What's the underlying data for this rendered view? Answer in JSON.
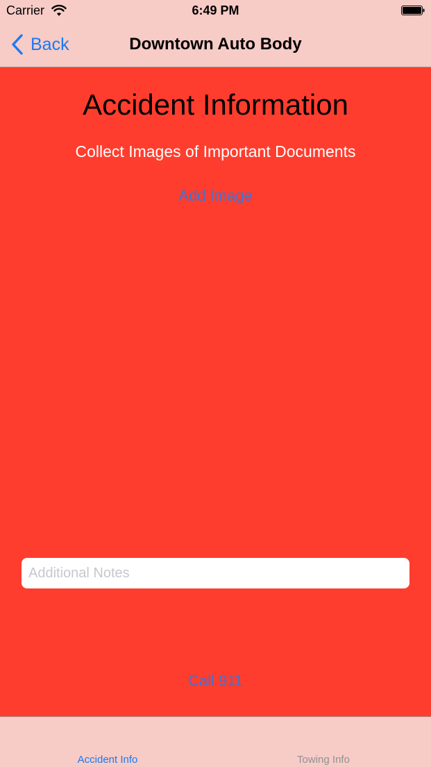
{
  "status_bar": {
    "carrier": "Carrier",
    "time": "6:49 PM"
  },
  "nav": {
    "back_label": "Back",
    "title": "Downtown Auto Body"
  },
  "main": {
    "title": "Accident Information",
    "subtitle": "Collect Images of Important Documents",
    "add_image_label": "Add Image",
    "notes": {
      "value": "",
      "placeholder": "Additional Notes"
    },
    "call_label": "Call 911"
  },
  "tabs": [
    {
      "label": "Accident Info",
      "active": true
    },
    {
      "label": "Towing Info",
      "active": false
    }
  ],
  "colors": {
    "bar_background": "#f7cbc6",
    "content_background": "#ff3d2e",
    "ios_blue": "#1a7af2",
    "link_blue": "#3b74d8",
    "inactive_gray": "#929292"
  },
  "icons": {
    "wifi": "wifi-icon",
    "battery": "battery-icon",
    "back": "chevron-left-icon"
  }
}
